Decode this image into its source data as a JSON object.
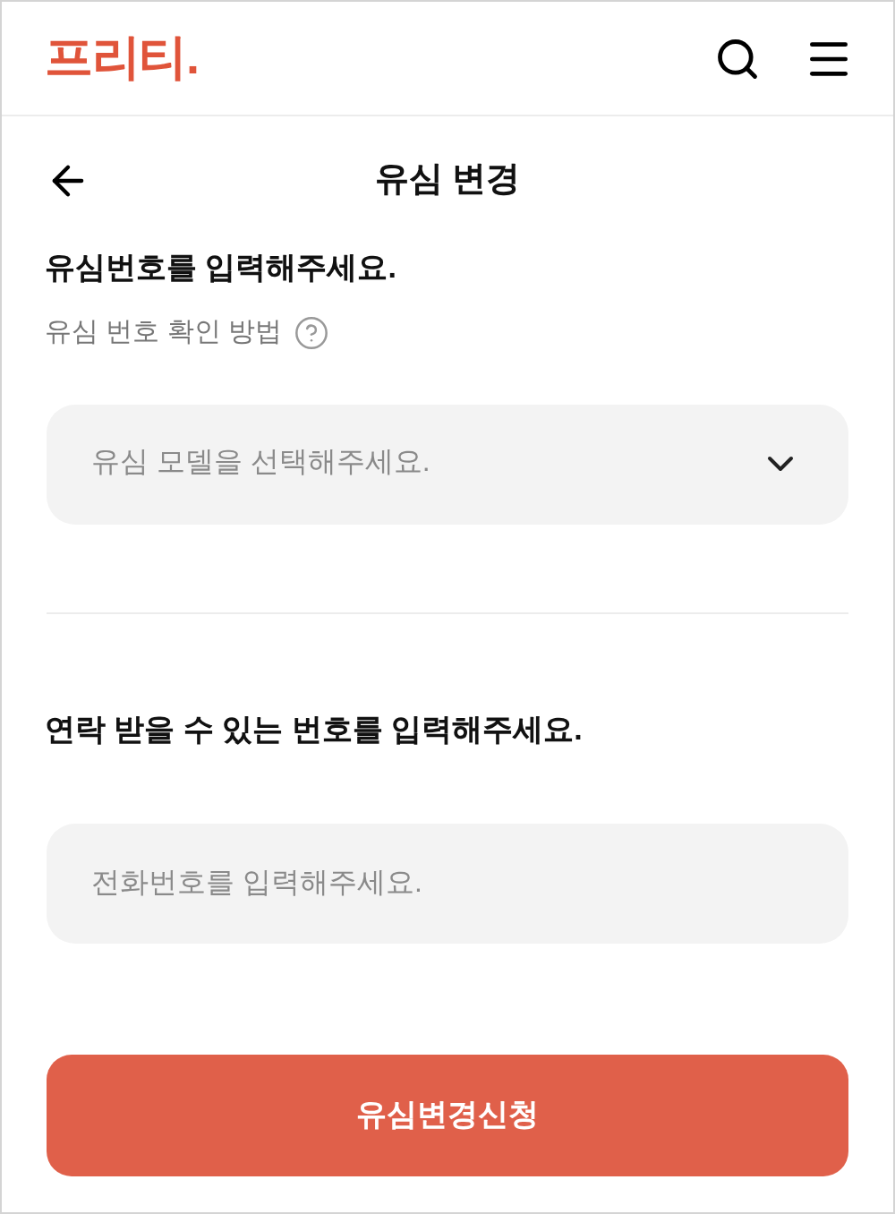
{
  "header": {
    "logo": "프리티."
  },
  "title_bar": {
    "title": "유심 변경"
  },
  "section": {
    "heading": "유심번호를 입력해주세요.",
    "help_link": "유심 번호 확인 방법"
  },
  "sim_model_select": {
    "placeholder": "유심 모델을 선택해주세요."
  },
  "contact": {
    "heading": "연락 받을 수 있는 번호를 입력해주세요.",
    "phone_field": {
      "placeholder": "전화번호를 입력해주세요."
    }
  },
  "submit_button": "유심변경신청"
}
